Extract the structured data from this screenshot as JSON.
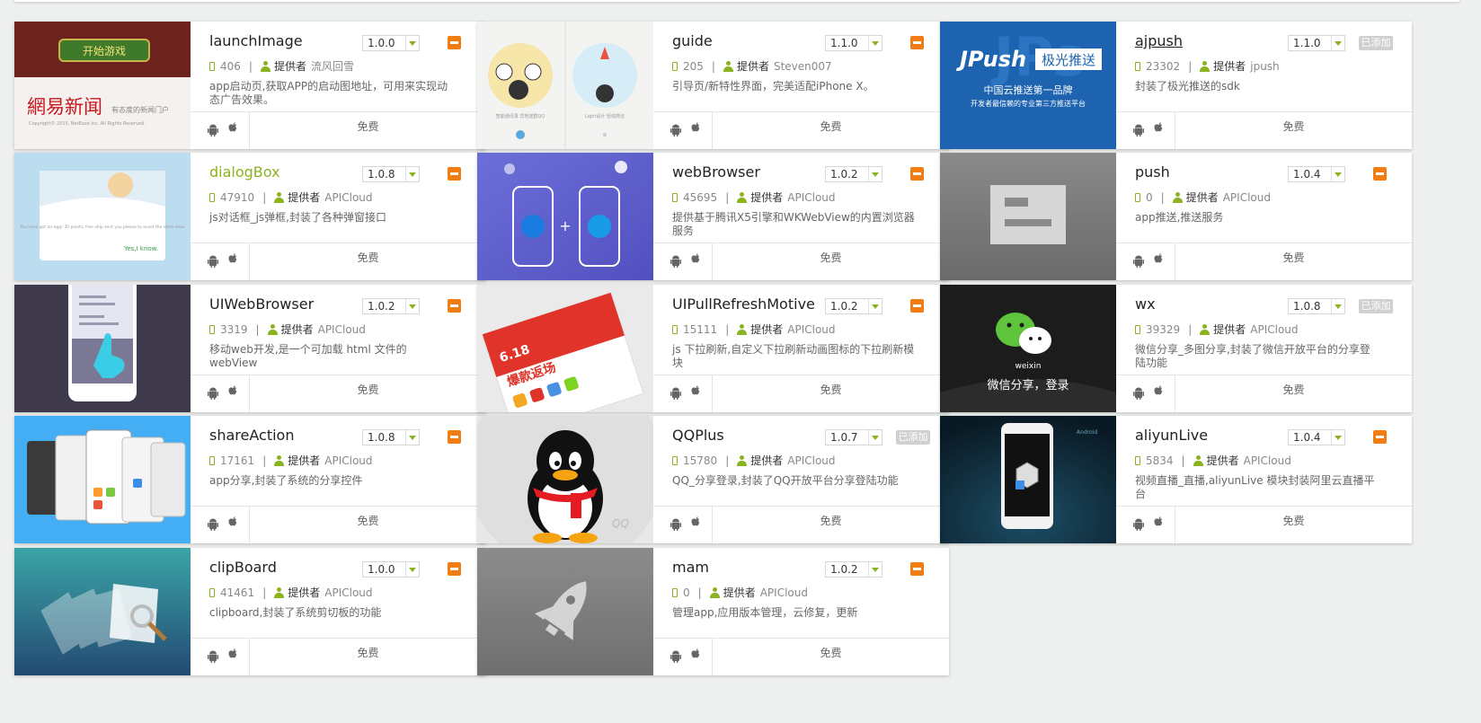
{
  "cards": [
    {
      "title": "launchImage",
      "version": "1.0.0",
      "downloads": "406",
      "provider_label": "提供者",
      "provider": "流风回雪",
      "description": "app启动页,获取APP的启动图地址，可用来实现动态广告效果。",
      "price": "免费",
      "status": "minus",
      "thumb_text": [
        "开始游戏",
        "網易新闻",
        "有态度的新闻门户",
        "Copyright© 2015, NetEase Inc. All Rights Reserved."
      ]
    },
    {
      "title": "guide",
      "version": "1.1.0",
      "downloads": "205",
      "provider_label": "提供者",
      "provider": "Steven007",
      "description": "引导页/新特性界面，完美适配iPhone X。",
      "price": "免费",
      "status": "minus",
      "thumb_text": [
        "智能通讯录 异地送群QQ",
        "Light设计 轻快简洁"
      ]
    },
    {
      "title": "ajpush",
      "version": "1.1.0",
      "downloads": "23302",
      "provider_label": "提供者",
      "provider": "jpush",
      "description": "封装了极光推送的sdk",
      "price": "免费",
      "status": "added",
      "added_label": "已添加",
      "thumb_text": [
        "JPush",
        "极光推送",
        "中国云推送第一品牌",
        "开发者最信赖的专业第三方推送平台"
      ]
    },
    {
      "title": "dialogBox",
      "version": "1.0.8",
      "downloads": "47910",
      "provider_label": "提供者",
      "provider": "APICloud",
      "description": "js对话框_js弹框,封装了各种弹窗接口",
      "price": "免费",
      "status": "minus",
      "thumb_text": [
        "You have got an egg! 20 points, free ship sent you please to avoid the store view.",
        "Yes,I know."
      ]
    },
    {
      "title": "webBrowser",
      "version": "1.0.2",
      "downloads": "45695",
      "provider_label": "提供者",
      "provider": "APICloud",
      "description": "提供基于腾讯X5引擎和WKWebView的内置浏览器服务",
      "price": "免费",
      "status": "minus",
      "thumb_text": []
    },
    {
      "title": "push",
      "version": "1.0.4",
      "downloads": "0",
      "provider_label": "提供者",
      "provider": "APICloud",
      "description": "app推送,推送服务",
      "price": "免费",
      "status": "minus",
      "thumb_text": []
    },
    {
      "title": "UIWebBrowser",
      "version": "1.0.2",
      "downloads": "3319",
      "provider_label": "提供者",
      "provider": "APICloud",
      "description": "移动web开发,是一个可加载 html 文件的 webView",
      "price": "免费",
      "status": "minus",
      "thumb_text": []
    },
    {
      "title": "UIPullRefreshMotive",
      "version": "1.0.2",
      "downloads": "15111",
      "provider_label": "提供者",
      "provider": "APICloud",
      "description": "js 下拉刷新,自定义下拉刷新动画图标的下拉刷新模块",
      "price": "免费",
      "status": "minus",
      "thumb_text": [
        "6.18",
        "爆款返场"
      ]
    },
    {
      "title": "wx",
      "version": "1.0.8",
      "downloads": "39329",
      "provider_label": "提供者",
      "provider": "APICloud",
      "description": "微信分享_多图分享,封装了微信开放平台的分享登陆功能",
      "price": "免费",
      "status": "added",
      "added_label": "已添加",
      "thumb_text": [
        "weixin",
        "微信分享，登录"
      ]
    },
    {
      "title": "shareAction",
      "version": "1.0.8",
      "downloads": "17161",
      "provider_label": "提供者",
      "provider": "APICloud",
      "description": "app分享,封装了系统的分享控件",
      "price": "免费",
      "status": "minus",
      "thumb_text": []
    },
    {
      "title": "QQPlus",
      "version": "1.0.7",
      "downloads": "15780",
      "provider_label": "提供者",
      "provider": "APICloud",
      "description": "QQ_分享登录,封装了QQ开放平台分享登陆功能",
      "price": "免费",
      "status": "added",
      "added_label": "已添加",
      "thumb_text": [
        "QQ"
      ]
    },
    {
      "title": "aliyunLive",
      "version": "1.0.4",
      "downloads": "5834",
      "provider_label": "提供者",
      "provider": "APICloud",
      "description": "视频直播_直播,aliyunLive 模块封装阿里云直播平台",
      "price": "免费",
      "status": "minus",
      "thumb_text": [
        "Android"
      ]
    },
    {
      "title": "clipBoard",
      "version": "1.0.0",
      "downloads": "41461",
      "provider_label": "提供者",
      "provider": "APICloud",
      "description": "clipboard,封装了系统剪切板的功能",
      "price": "免费",
      "status": "minus",
      "thumb_text": []
    },
    {
      "title": "mam",
      "version": "1.0.2",
      "downloads": "0",
      "provider_label": "提供者",
      "provider": "APICloud",
      "description": "管理app,应用版本管理，云修复，更新",
      "price": "免费",
      "status": "minus",
      "thumb_text": []
    }
  ],
  "colors": {
    "accent_green": "#8ab31f",
    "minus_orange": "#f07c12",
    "added_gray": "#d0d0d0"
  },
  "icons": [
    "phone-icon",
    "user-icon",
    "android-icon",
    "apple-icon",
    "dropdown-arrow-icon",
    "remove-icon"
  ]
}
